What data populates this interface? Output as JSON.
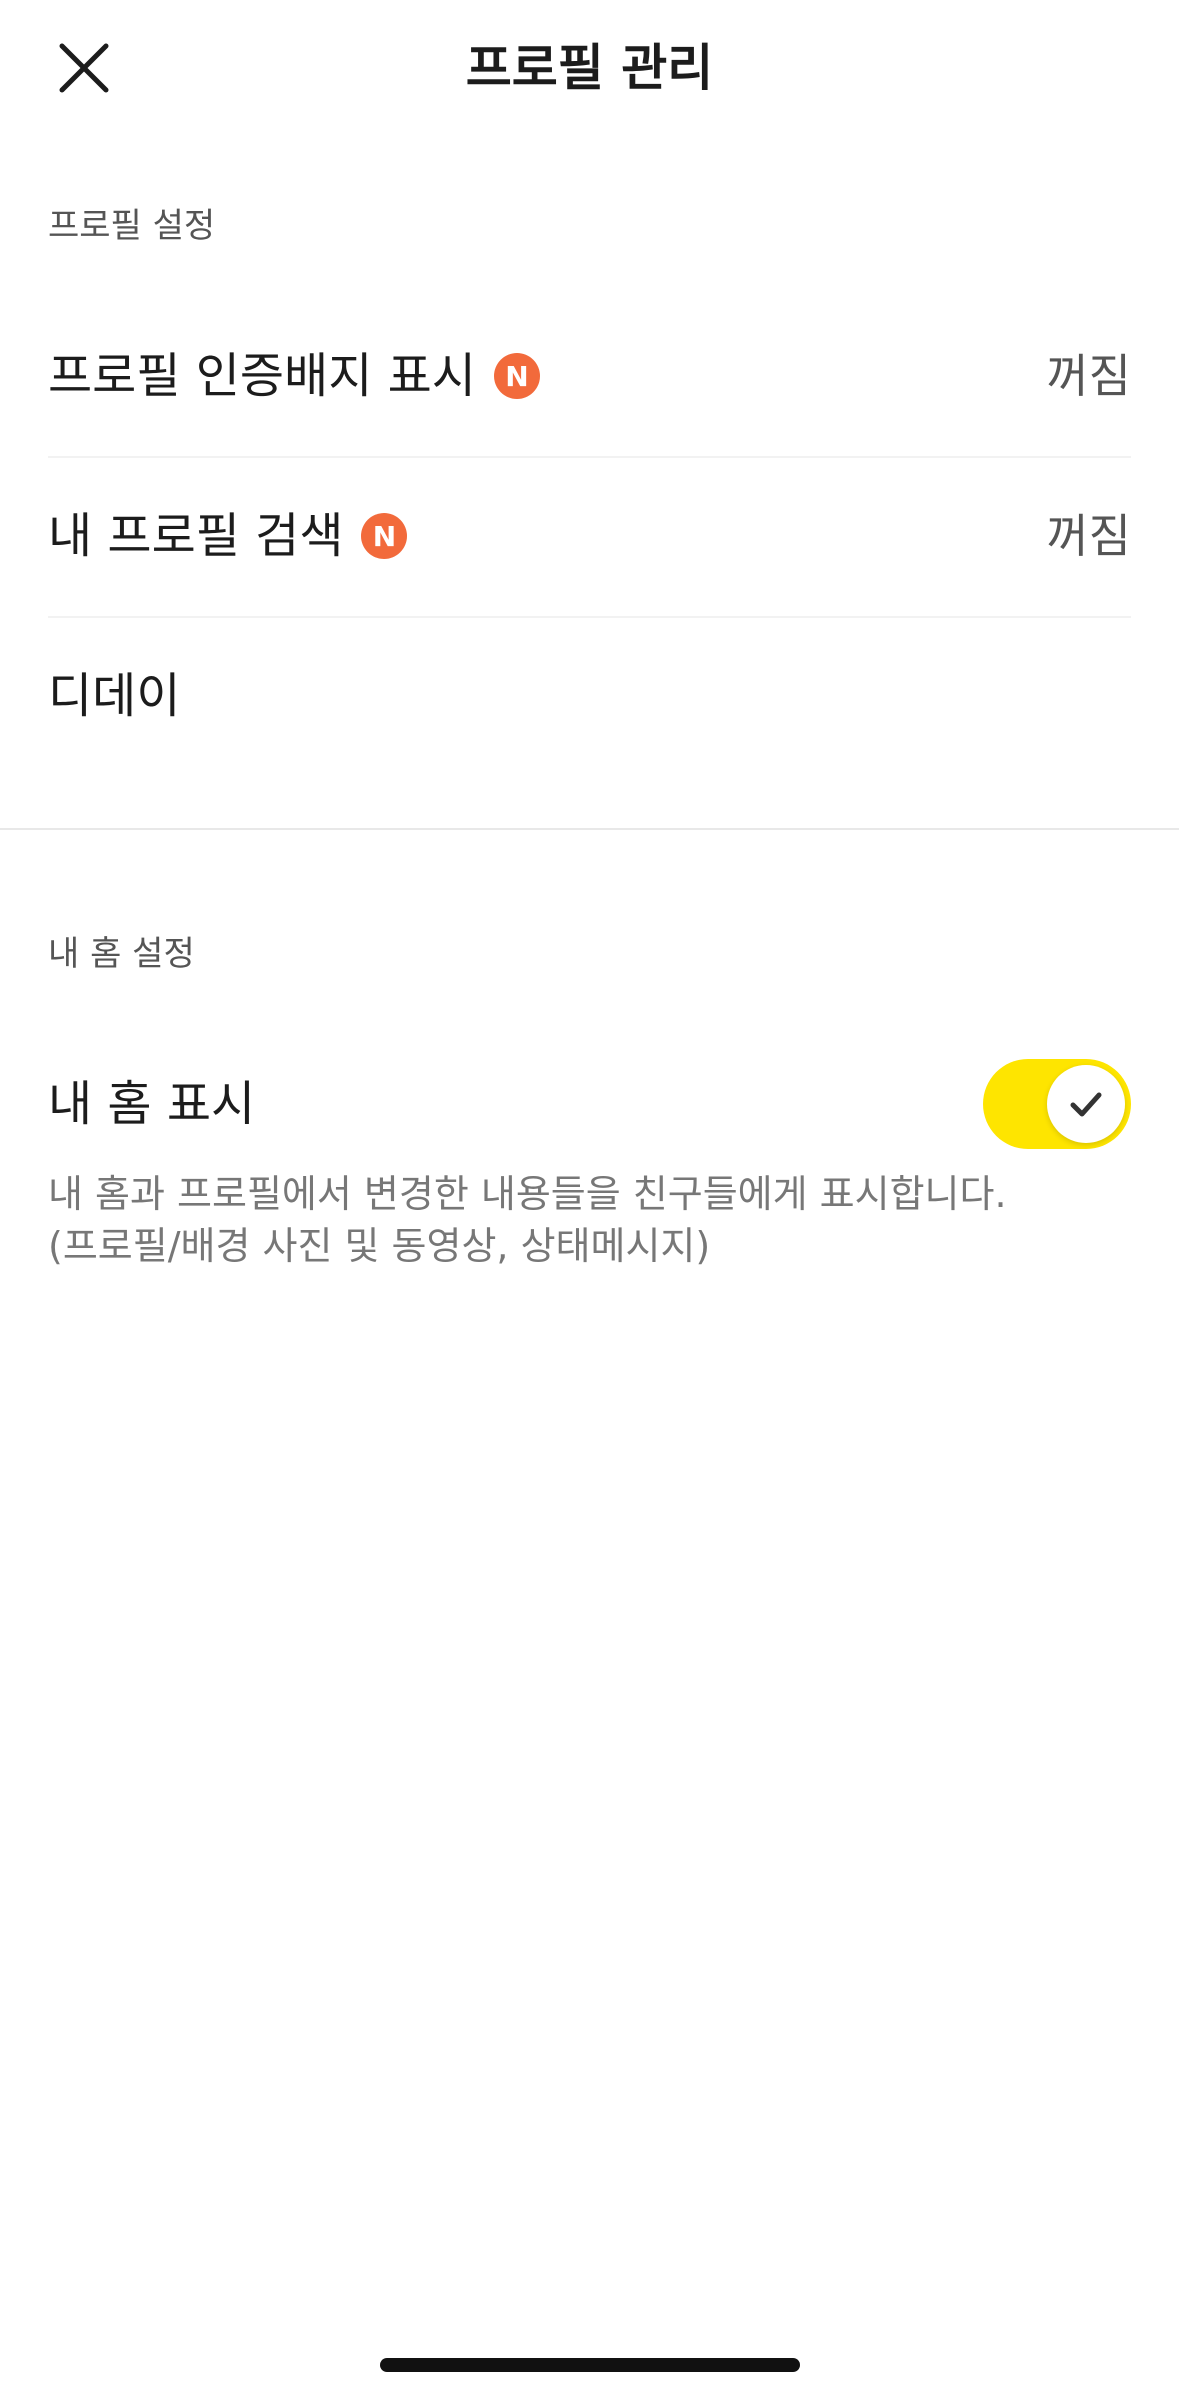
{
  "header": {
    "title": "프로필 관리",
    "close_icon": "close-icon"
  },
  "profile_settings": {
    "section_title": "프로필 설정",
    "items": [
      {
        "label": "프로필 인증배지 표시",
        "badge": "N",
        "value": "꺼짐"
      },
      {
        "label": "내 프로필 검색",
        "badge": "N",
        "value": "꺼짐"
      },
      {
        "label": "디데이"
      }
    ]
  },
  "home_settings": {
    "section_title": "내 홈 설정",
    "show_home": {
      "label": "내 홈 표시",
      "enabled": true,
      "description_line1": "내 홈과 프로필에서 변경한 내용들을 친구들에게 표시합니다.",
      "description_line2": "(프로필/배경 사진 및 동영상, 상태메시지)"
    }
  },
  "colors": {
    "toggle_on": "#fee500",
    "new_badge": "#f26a3b",
    "text_primary": "#1c1c1c",
    "text_secondary": "#555555"
  }
}
